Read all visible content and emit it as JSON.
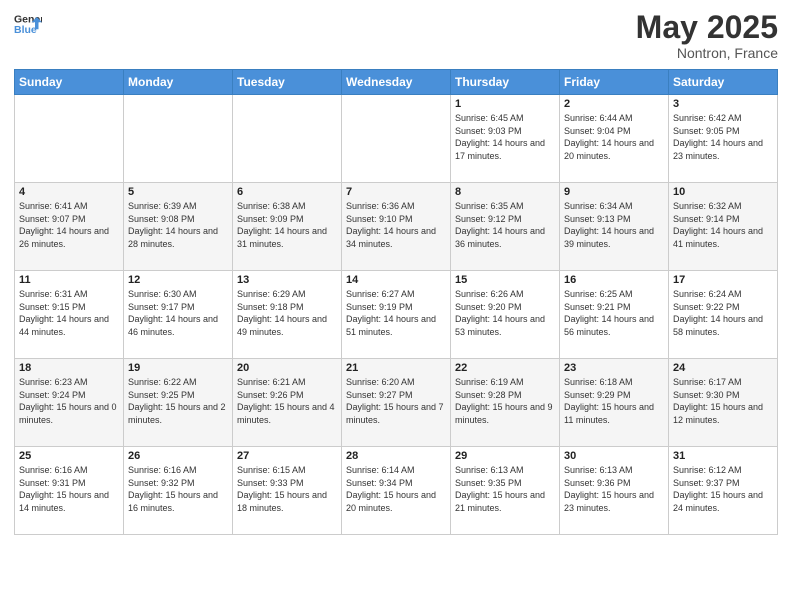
{
  "header": {
    "logo_line1": "General",
    "logo_line2": "Blue",
    "month": "May 2025",
    "location": "Nontron, France"
  },
  "weekdays": [
    "Sunday",
    "Monday",
    "Tuesday",
    "Wednesday",
    "Thursday",
    "Friday",
    "Saturday"
  ],
  "weeks": [
    [
      {
        "day": "",
        "info": ""
      },
      {
        "day": "",
        "info": ""
      },
      {
        "day": "",
        "info": ""
      },
      {
        "day": "",
        "info": ""
      },
      {
        "day": "1",
        "info": "Sunrise: 6:45 AM\nSunset: 9:03 PM\nDaylight: 14 hours and 17 minutes."
      },
      {
        "day": "2",
        "info": "Sunrise: 6:44 AM\nSunset: 9:04 PM\nDaylight: 14 hours and 20 minutes."
      },
      {
        "day": "3",
        "info": "Sunrise: 6:42 AM\nSunset: 9:05 PM\nDaylight: 14 hours and 23 minutes."
      }
    ],
    [
      {
        "day": "4",
        "info": "Sunrise: 6:41 AM\nSunset: 9:07 PM\nDaylight: 14 hours and 26 minutes."
      },
      {
        "day": "5",
        "info": "Sunrise: 6:39 AM\nSunset: 9:08 PM\nDaylight: 14 hours and 28 minutes."
      },
      {
        "day": "6",
        "info": "Sunrise: 6:38 AM\nSunset: 9:09 PM\nDaylight: 14 hours and 31 minutes."
      },
      {
        "day": "7",
        "info": "Sunrise: 6:36 AM\nSunset: 9:10 PM\nDaylight: 14 hours and 34 minutes."
      },
      {
        "day": "8",
        "info": "Sunrise: 6:35 AM\nSunset: 9:12 PM\nDaylight: 14 hours and 36 minutes."
      },
      {
        "day": "9",
        "info": "Sunrise: 6:34 AM\nSunset: 9:13 PM\nDaylight: 14 hours and 39 minutes."
      },
      {
        "day": "10",
        "info": "Sunrise: 6:32 AM\nSunset: 9:14 PM\nDaylight: 14 hours and 41 minutes."
      }
    ],
    [
      {
        "day": "11",
        "info": "Sunrise: 6:31 AM\nSunset: 9:15 PM\nDaylight: 14 hours and 44 minutes."
      },
      {
        "day": "12",
        "info": "Sunrise: 6:30 AM\nSunset: 9:17 PM\nDaylight: 14 hours and 46 minutes."
      },
      {
        "day": "13",
        "info": "Sunrise: 6:29 AM\nSunset: 9:18 PM\nDaylight: 14 hours and 49 minutes."
      },
      {
        "day": "14",
        "info": "Sunrise: 6:27 AM\nSunset: 9:19 PM\nDaylight: 14 hours and 51 minutes."
      },
      {
        "day": "15",
        "info": "Sunrise: 6:26 AM\nSunset: 9:20 PM\nDaylight: 14 hours and 53 minutes."
      },
      {
        "day": "16",
        "info": "Sunrise: 6:25 AM\nSunset: 9:21 PM\nDaylight: 14 hours and 56 minutes."
      },
      {
        "day": "17",
        "info": "Sunrise: 6:24 AM\nSunset: 9:22 PM\nDaylight: 14 hours and 58 minutes."
      }
    ],
    [
      {
        "day": "18",
        "info": "Sunrise: 6:23 AM\nSunset: 9:24 PM\nDaylight: 15 hours and 0 minutes."
      },
      {
        "day": "19",
        "info": "Sunrise: 6:22 AM\nSunset: 9:25 PM\nDaylight: 15 hours and 2 minutes."
      },
      {
        "day": "20",
        "info": "Sunrise: 6:21 AM\nSunset: 9:26 PM\nDaylight: 15 hours and 4 minutes."
      },
      {
        "day": "21",
        "info": "Sunrise: 6:20 AM\nSunset: 9:27 PM\nDaylight: 15 hours and 7 minutes."
      },
      {
        "day": "22",
        "info": "Sunrise: 6:19 AM\nSunset: 9:28 PM\nDaylight: 15 hours and 9 minutes."
      },
      {
        "day": "23",
        "info": "Sunrise: 6:18 AM\nSunset: 9:29 PM\nDaylight: 15 hours and 11 minutes."
      },
      {
        "day": "24",
        "info": "Sunrise: 6:17 AM\nSunset: 9:30 PM\nDaylight: 15 hours and 12 minutes."
      }
    ],
    [
      {
        "day": "25",
        "info": "Sunrise: 6:16 AM\nSunset: 9:31 PM\nDaylight: 15 hours and 14 minutes."
      },
      {
        "day": "26",
        "info": "Sunrise: 6:16 AM\nSunset: 9:32 PM\nDaylight: 15 hours and 16 minutes."
      },
      {
        "day": "27",
        "info": "Sunrise: 6:15 AM\nSunset: 9:33 PM\nDaylight: 15 hours and 18 minutes."
      },
      {
        "day": "28",
        "info": "Sunrise: 6:14 AM\nSunset: 9:34 PM\nDaylight: 15 hours and 20 minutes."
      },
      {
        "day": "29",
        "info": "Sunrise: 6:13 AM\nSunset: 9:35 PM\nDaylight: 15 hours and 21 minutes."
      },
      {
        "day": "30",
        "info": "Sunrise: 6:13 AM\nSunset: 9:36 PM\nDaylight: 15 hours and 23 minutes."
      },
      {
        "day": "31",
        "info": "Sunrise: 6:12 AM\nSunset: 9:37 PM\nDaylight: 15 hours and 24 minutes."
      }
    ]
  ]
}
